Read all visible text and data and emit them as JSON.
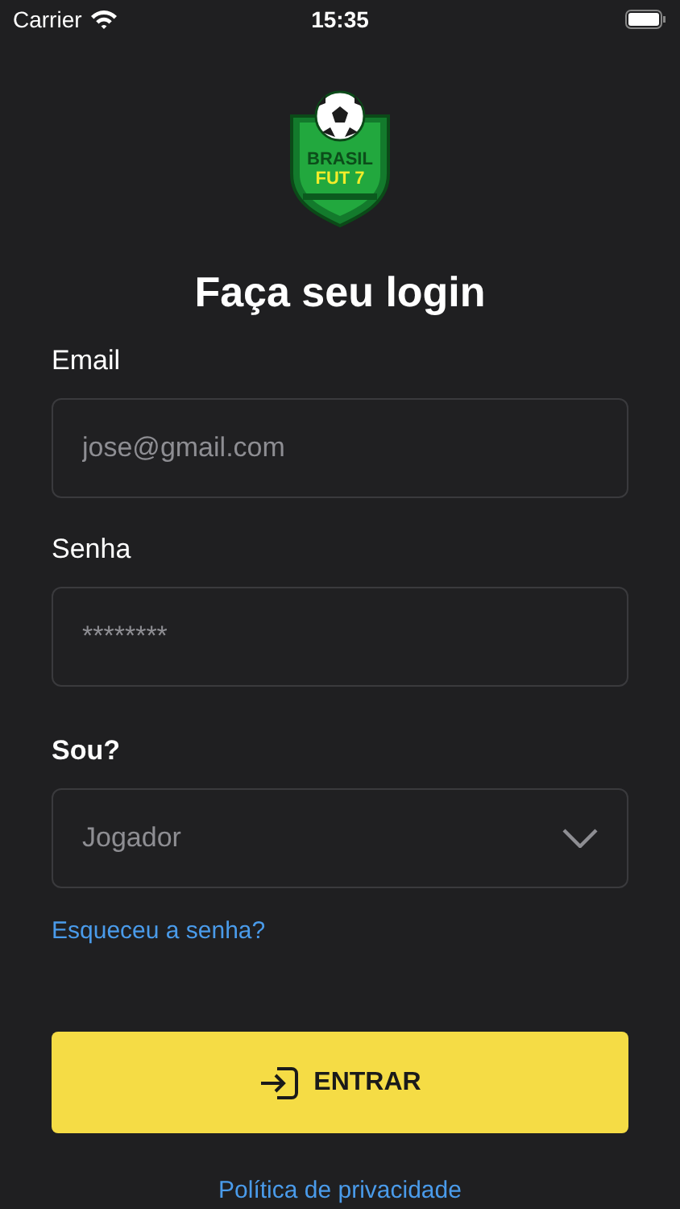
{
  "status_bar": {
    "carrier": "Carrier",
    "time": "15:35"
  },
  "logo": {
    "line_1": "BRASIL",
    "line_2": "FUT 7"
  },
  "title": "Faça seu login",
  "fields": [
    {
      "kind": "text",
      "label": "Email",
      "placeholder": "jose@gmail.com"
    },
    {
      "kind": "text",
      "label": "Senha",
      "placeholder": "********"
    },
    {
      "kind": "select",
      "label": "Sou?",
      "value": "Jogador"
    }
  ],
  "forgot_link": "Esqueceu a senha?",
  "submit_button": "ENTRAR",
  "privacy_link": "Política de privacidade"
}
